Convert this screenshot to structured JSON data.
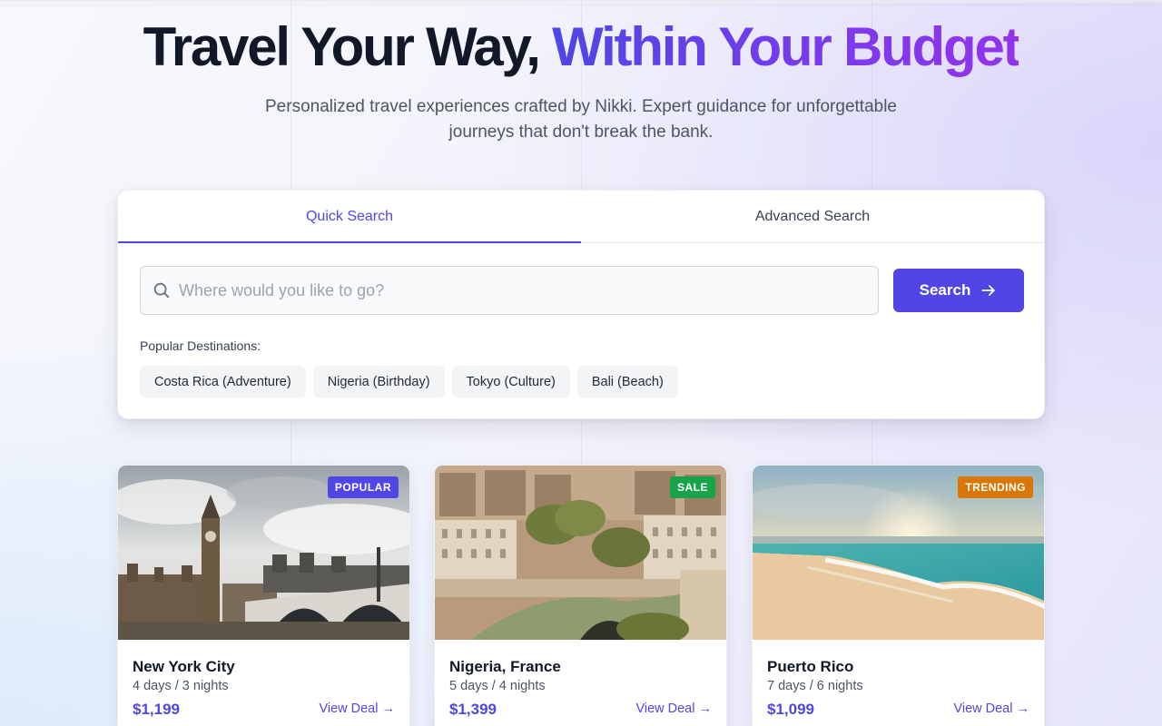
{
  "hero": {
    "title_plain": "Travel Your Way, ",
    "title_highlight": "Within Your Budget",
    "subtitle": "Personalized travel experiences crafted by Nikki. Expert guidance for unforgettable journeys that don't break the bank."
  },
  "search": {
    "tabs": [
      {
        "label": "Quick Search",
        "active": true
      },
      {
        "label": "Advanced Search",
        "active": false
      }
    ],
    "placeholder": "Where would you like to go?",
    "value": "",
    "button_label": "Search",
    "popular_label": "Popular Destinations:",
    "popular": [
      "Costa Rica (Adventure)",
      "Nigeria (Birthday)",
      "Tokyo (Culture)",
      "Bali (Beach)"
    ]
  },
  "deals": [
    {
      "title": "New York City",
      "duration": "4 days / 3 nights",
      "price": "$1,199",
      "link": "View Deal →",
      "badge": "POPULAR",
      "badge_color": "#4f46e5",
      "image": "london-bridge-photo"
    },
    {
      "title": "Nigeria, France",
      "duration": "5 days / 4 nights",
      "price": "$1,399",
      "link": "View Deal →",
      "badge": "SALE",
      "badge_color": "#16a34a",
      "image": "paris-city-photo"
    },
    {
      "title": "Puerto Rico",
      "duration": "7 days / 6 nights",
      "price": "$1,099",
      "link": "View Deal →",
      "badge": "TRENDING",
      "badge_color": "#d97706",
      "image": "beach-sunset-photo"
    }
  ],
  "colors": {
    "accent": "#4f46e5",
    "gradient_end": "#9333ea"
  }
}
